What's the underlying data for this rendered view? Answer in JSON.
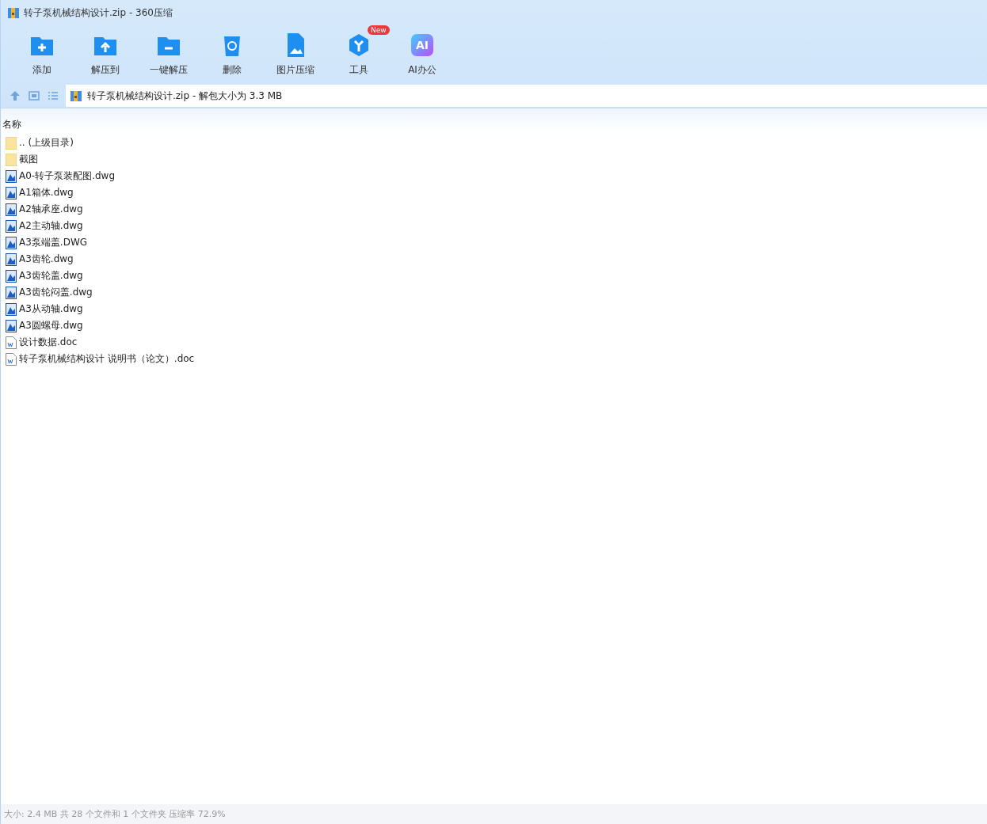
{
  "window": {
    "title": "转子泵机械结构设计.zip - 360压缩"
  },
  "toolbar": [
    {
      "label": "添加",
      "kind": "add"
    },
    {
      "label": "解压到",
      "kind": "extract"
    },
    {
      "label": "一键解压",
      "kind": "oneclick"
    },
    {
      "label": "删除",
      "kind": "delete"
    },
    {
      "label": "图片压缩",
      "kind": "image"
    },
    {
      "label": "工具",
      "kind": "tools",
      "badge": "New"
    },
    {
      "label": "AI办公",
      "kind": "ai",
      "icon_text": "AI"
    }
  ],
  "address": {
    "text": "转子泵机械结构设计.zip - 解包大小为 3.3 MB"
  },
  "table": {
    "columns": [
      "名称"
    ],
    "rows": [
      {
        "name": ".. (上级目录)",
        "kind": "folder"
      },
      {
        "name": "截图",
        "kind": "folder"
      },
      {
        "name": "A0-转子泵装配图.dwg",
        "kind": "dwg"
      },
      {
        "name": "A1箱体.dwg",
        "kind": "dwg"
      },
      {
        "name": "A2轴承座.dwg",
        "kind": "dwg"
      },
      {
        "name": "A2主动轴.dwg",
        "kind": "dwg"
      },
      {
        "name": "A3泵端盖.DWG",
        "kind": "dwg"
      },
      {
        "name": "A3齿轮.dwg",
        "kind": "dwg"
      },
      {
        "name": "A3齿轮盖.dwg",
        "kind": "dwg"
      },
      {
        "name": "A3齿轮闷盖.dwg",
        "kind": "dwg"
      },
      {
        "name": "A3从动轴.dwg",
        "kind": "dwg"
      },
      {
        "name": "A3圆螺母.dwg",
        "kind": "dwg"
      },
      {
        "name": "设计数据.doc",
        "kind": "doc"
      },
      {
        "name": "转子泵机械结构设计 说明书（论文）.doc",
        "kind": "doc"
      }
    ]
  },
  "status_bar": "大小: 2.4 MB 共 28 个文件和 1 个文件夹 压缩率 72.9%"
}
